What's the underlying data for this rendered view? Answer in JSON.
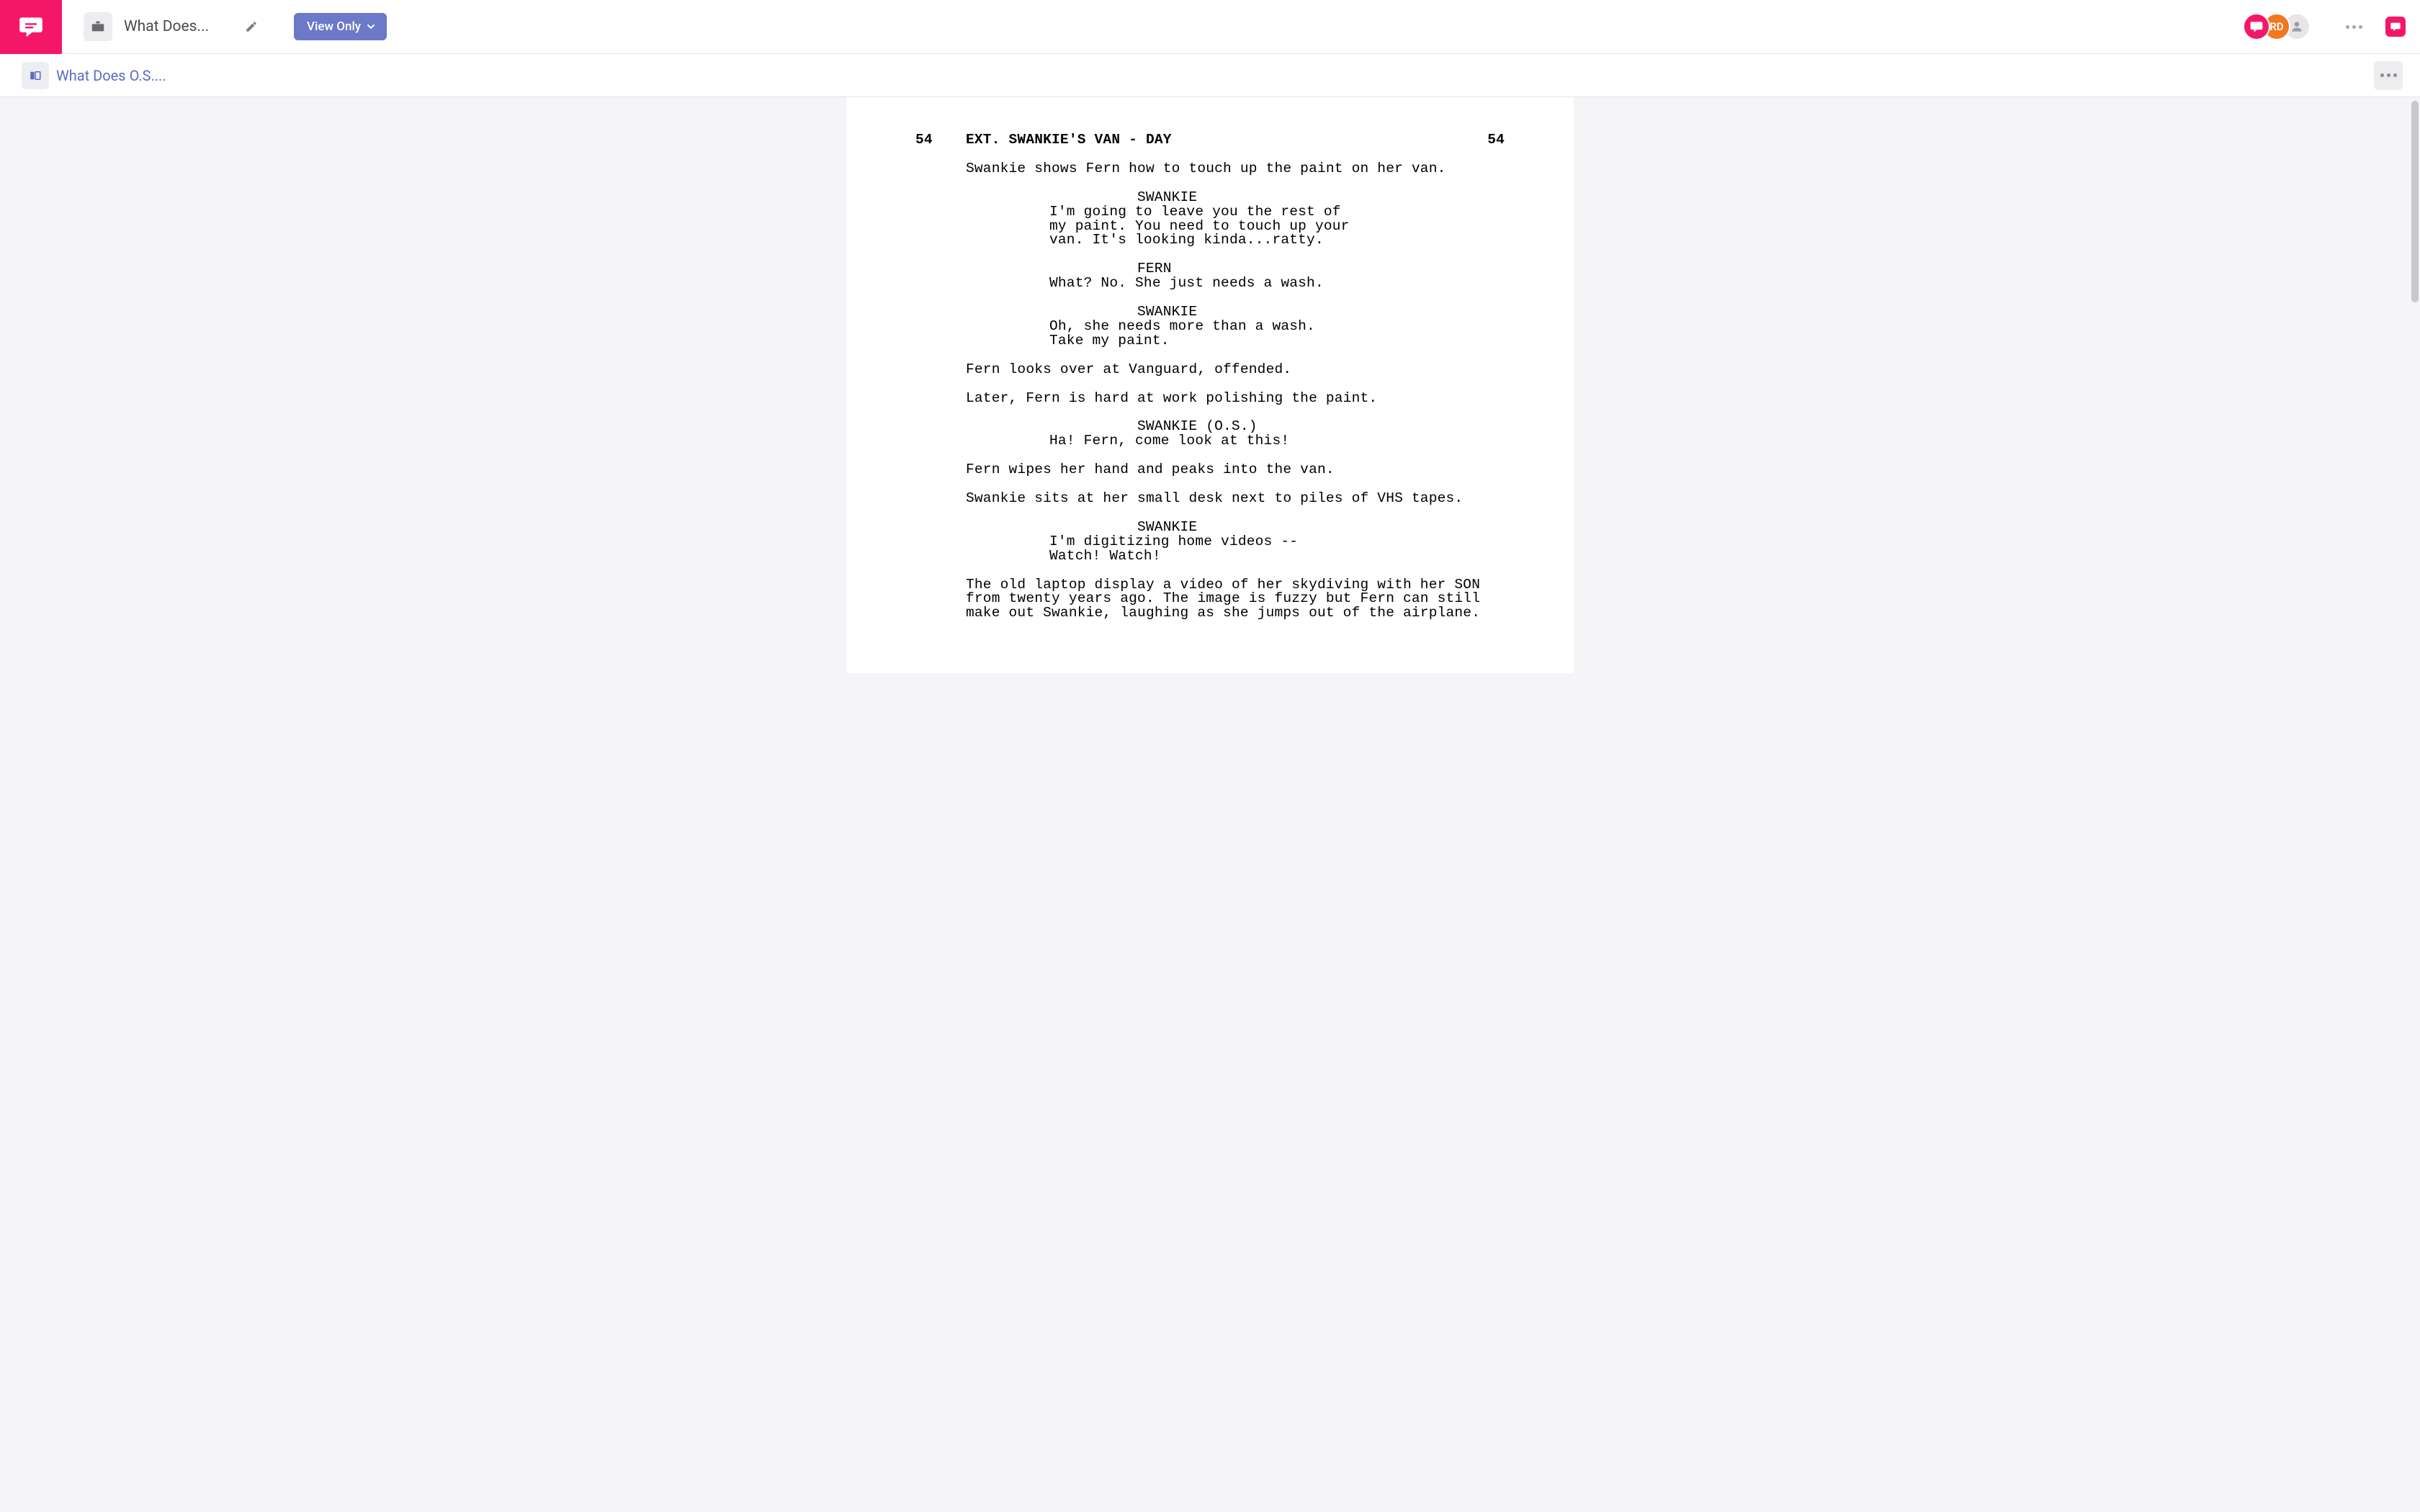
{
  "toolbar": {
    "doc_title": "What Does...",
    "view_label": "View Only",
    "avatar2_initials": "RD"
  },
  "subbar": {
    "tab_label": "What Does O.S...."
  },
  "scene": {
    "number": "54",
    "heading": "EXT. SWANKIE'S VAN - DAY"
  },
  "blocks": {
    "action1": "Swankie shows Fern how to touch up the paint on her van.",
    "char1": "SWANKIE",
    "dlg1": "I'm going to leave you the rest of\nmy paint. You need to touch up your\nvan. It's looking kinda...ratty.",
    "char2": "FERN",
    "dlg2": "What? No. She just needs a wash.",
    "char3": "SWANKIE",
    "dlg3": "Oh, she needs more than a wash.\nTake my paint.",
    "action2": "Fern looks over at Vanguard, offended.",
    "action3": "Later, Fern is hard at work polishing the paint.",
    "char4": "SWANKIE (O.S.)",
    "dlg4": "Ha! Fern, come look at this!",
    "action4": "Fern wipes her hand and peaks into the van.",
    "action5": "Swankie sits at her small desk next to piles of VHS tapes.",
    "char5": "SWANKIE",
    "dlg5": "I'm digitizing home videos --\nWatch! Watch!",
    "action6": "The old laptop display a video of her skydiving with her SON\nfrom twenty years ago. The image is fuzzy but Fern can still\nmake out Swankie, laughing as she jumps out of the airplane."
  }
}
